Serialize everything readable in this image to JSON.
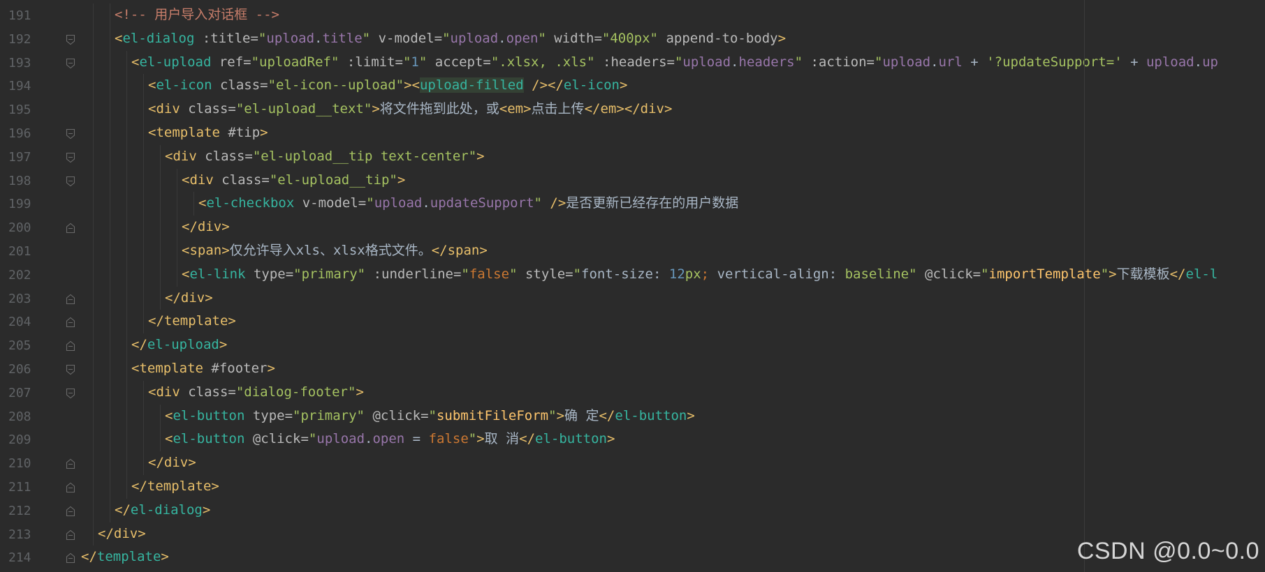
{
  "editor": {
    "watermark": "CSDN @0.0~0.0",
    "colors": {
      "background": "#2b2b2b",
      "line_number": "#606366",
      "tag": "#36b5a0",
      "tag_yellow": "#e8bf6a",
      "string": "#a5c261",
      "variable": "#9876aa",
      "keyword": "#cc7832",
      "comment": "#c67d6a"
    },
    "lines": [
      {
        "num": "191",
        "fold": "none",
        "indent": 2,
        "tokens": [
          {
            "t": "<!-- 用户导入对话框 -->",
            "c": "comment"
          }
        ]
      },
      {
        "num": "192",
        "fold": "open",
        "indent": 2,
        "tokens": [
          {
            "t": "<",
            "c": "brk"
          },
          {
            "t": "el-dialog",
            "c": "tag"
          },
          {
            "t": " :title=",
            "c": "attr"
          },
          {
            "t": "\"",
            "c": "str"
          },
          {
            "t": "upload",
            "c": "var"
          },
          {
            "t": ".",
            "c": "plain"
          },
          {
            "t": "title",
            "c": "var"
          },
          {
            "t": "\"",
            "c": "str"
          },
          {
            "t": " v-model=",
            "c": "attr"
          },
          {
            "t": "\"",
            "c": "str"
          },
          {
            "t": "upload",
            "c": "var"
          },
          {
            "t": ".",
            "c": "plain"
          },
          {
            "t": "open",
            "c": "var"
          },
          {
            "t": "\"",
            "c": "str"
          },
          {
            "t": " width=",
            "c": "attr"
          },
          {
            "t": "\"400px\"",
            "c": "str"
          },
          {
            "t": " append-to-body",
            "c": "attr"
          },
          {
            "t": ">",
            "c": "brk"
          }
        ]
      },
      {
        "num": "193",
        "fold": "open",
        "indent": 3,
        "tokens": [
          {
            "t": "<",
            "c": "brk"
          },
          {
            "t": "el-upload",
            "c": "tag"
          },
          {
            "t": " ref=",
            "c": "attr"
          },
          {
            "t": "\"uploadRef\"",
            "c": "str"
          },
          {
            "t": " :limit=",
            "c": "attr"
          },
          {
            "t": "\"",
            "c": "str"
          },
          {
            "t": "1",
            "c": "num"
          },
          {
            "t": "\"",
            "c": "str"
          },
          {
            "t": " accept=",
            "c": "attr"
          },
          {
            "t": "\".xlsx, .xls\"",
            "c": "str"
          },
          {
            "t": " :headers=",
            "c": "attr"
          },
          {
            "t": "\"",
            "c": "str"
          },
          {
            "t": "upload",
            "c": "var"
          },
          {
            "t": ".",
            "c": "plain"
          },
          {
            "t": "headers",
            "c": "var"
          },
          {
            "t": "\"",
            "c": "str"
          },
          {
            "t": " :action=",
            "c": "attr"
          },
          {
            "t": "\"",
            "c": "str"
          },
          {
            "t": "upload",
            "c": "var"
          },
          {
            "t": ".",
            "c": "plain"
          },
          {
            "t": "url",
            "c": "var"
          },
          {
            "t": " + ",
            "c": "plain"
          },
          {
            "t": "'?updateSupport='",
            "c": "str"
          },
          {
            "t": " + ",
            "c": "plain"
          },
          {
            "t": "upload",
            "c": "var"
          },
          {
            "t": ".",
            "c": "plain"
          },
          {
            "t": "up",
            "c": "var"
          }
        ]
      },
      {
        "num": "194",
        "fold": "none",
        "indent": 4,
        "tokens": [
          {
            "t": "<",
            "c": "brk"
          },
          {
            "t": "el-icon",
            "c": "tag"
          },
          {
            "t": " class=",
            "c": "attr"
          },
          {
            "t": "\"el-icon--upload\"",
            "c": "str"
          },
          {
            "t": "><",
            "c": "brk"
          },
          {
            "t": "upload-filled",
            "c": "tag",
            "hl": true
          },
          {
            "t": " />",
            "c": "brk"
          },
          {
            "t": "</",
            "c": "brk"
          },
          {
            "t": "el-icon",
            "c": "tag"
          },
          {
            "t": ">",
            "c": "brk"
          }
        ]
      },
      {
        "num": "195",
        "fold": "none",
        "indent": 4,
        "tokens": [
          {
            "t": "<div",
            "c": "tagy"
          },
          {
            "t": " class=",
            "c": "attr"
          },
          {
            "t": "\"el-upload__text\"",
            "c": "str"
          },
          {
            "t": ">",
            "c": "tagy"
          },
          {
            "t": "将文件拖到此处，或",
            "c": "plain"
          },
          {
            "t": "<em>",
            "c": "tagy"
          },
          {
            "t": "点击上传",
            "c": "plain"
          },
          {
            "t": "</em></div>",
            "c": "tagy"
          }
        ]
      },
      {
        "num": "196",
        "fold": "open",
        "indent": 4,
        "tokens": [
          {
            "t": "<template",
            "c": "tagy"
          },
          {
            "t": " #tip",
            "c": "attr"
          },
          {
            "t": ">",
            "c": "tagy"
          }
        ]
      },
      {
        "num": "197",
        "fold": "open",
        "indent": 5,
        "tokens": [
          {
            "t": "<div",
            "c": "tagy"
          },
          {
            "t": " class=",
            "c": "attr"
          },
          {
            "t": "\"el-upload__tip text-center\"",
            "c": "str"
          },
          {
            "t": ">",
            "c": "tagy"
          }
        ]
      },
      {
        "num": "198",
        "fold": "open",
        "indent": 6,
        "tokens": [
          {
            "t": "<div",
            "c": "tagy"
          },
          {
            "t": " class=",
            "c": "attr"
          },
          {
            "t": "\"el-upload__tip\"",
            "c": "str"
          },
          {
            "t": ">",
            "c": "tagy"
          }
        ]
      },
      {
        "num": "199",
        "fold": "none",
        "indent": 7,
        "tokens": [
          {
            "t": "<",
            "c": "brk"
          },
          {
            "t": "el-checkbox",
            "c": "tag"
          },
          {
            "t": " v-model=",
            "c": "attr"
          },
          {
            "t": "\"",
            "c": "str"
          },
          {
            "t": "upload",
            "c": "var"
          },
          {
            "t": ".",
            "c": "plain"
          },
          {
            "t": "updateSupport",
            "c": "var"
          },
          {
            "t": "\"",
            "c": "str"
          },
          {
            "t": " />",
            "c": "brk"
          },
          {
            "t": "是否更新已经存在的用户数据",
            "c": "plain"
          }
        ]
      },
      {
        "num": "200",
        "fold": "close",
        "indent": 6,
        "tokens": [
          {
            "t": "</div>",
            "c": "tagy"
          }
        ]
      },
      {
        "num": "201",
        "fold": "none",
        "indent": 6,
        "tokens": [
          {
            "t": "<span>",
            "c": "tagy"
          },
          {
            "t": "仅允许导入xls、xlsx格式文件。",
            "c": "plain"
          },
          {
            "t": "</span>",
            "c": "tagy"
          }
        ]
      },
      {
        "num": "202",
        "fold": "none",
        "indent": 6,
        "tokens": [
          {
            "t": "<",
            "c": "brk"
          },
          {
            "t": "el-link",
            "c": "tag"
          },
          {
            "t": " type=",
            "c": "attr"
          },
          {
            "t": "\"primary\"",
            "c": "str"
          },
          {
            "t": " :underline=",
            "c": "attr"
          },
          {
            "t": "\"",
            "c": "str"
          },
          {
            "t": "false",
            "c": "kw"
          },
          {
            "t": "\"",
            "c": "str"
          },
          {
            "t": " style=",
            "c": "attr"
          },
          {
            "t": "\"",
            "c": "str"
          },
          {
            "t": "font-size: ",
            "c": "plain"
          },
          {
            "t": "12",
            "c": "num"
          },
          {
            "t": "px",
            "c": "str"
          },
          {
            "t": "; ",
            "c": "kw"
          },
          {
            "t": "vertical-align: ",
            "c": "plain"
          },
          {
            "t": "baseline",
            "c": "str"
          },
          {
            "t": "\"",
            "c": "str"
          },
          {
            "t": " @click=",
            "c": "attr"
          },
          {
            "t": "\"",
            "c": "str"
          },
          {
            "t": "importTemplate",
            "c": "fn"
          },
          {
            "t": "\"",
            "c": "str"
          },
          {
            "t": ">",
            "c": "brk"
          },
          {
            "t": "下载模板",
            "c": "plain"
          },
          {
            "t": "</",
            "c": "brk"
          },
          {
            "t": "el-l",
            "c": "tag"
          }
        ]
      },
      {
        "num": "203",
        "fold": "close",
        "indent": 5,
        "tokens": [
          {
            "t": "</div>",
            "c": "tagy"
          }
        ]
      },
      {
        "num": "204",
        "fold": "close",
        "indent": 4,
        "tokens": [
          {
            "t": "</template>",
            "c": "tagy"
          }
        ]
      },
      {
        "num": "205",
        "fold": "close",
        "indent": 3,
        "tokens": [
          {
            "t": "</",
            "c": "brk"
          },
          {
            "t": "el-upload",
            "c": "tag"
          },
          {
            "t": ">",
            "c": "brk"
          }
        ]
      },
      {
        "num": "206",
        "fold": "open",
        "indent": 3,
        "tokens": [
          {
            "t": "<template",
            "c": "tagy"
          },
          {
            "t": " #footer",
            "c": "attr"
          },
          {
            "t": ">",
            "c": "tagy"
          }
        ]
      },
      {
        "num": "207",
        "fold": "open",
        "indent": 4,
        "tokens": [
          {
            "t": "<div",
            "c": "tagy"
          },
          {
            "t": " class=",
            "c": "attr"
          },
          {
            "t": "\"dialog-footer\"",
            "c": "str"
          },
          {
            "t": ">",
            "c": "tagy"
          }
        ]
      },
      {
        "num": "208",
        "fold": "none",
        "indent": 5,
        "tokens": [
          {
            "t": "<",
            "c": "brk"
          },
          {
            "t": "el-button",
            "c": "tag"
          },
          {
            "t": " type=",
            "c": "attr"
          },
          {
            "t": "\"primary\"",
            "c": "str"
          },
          {
            "t": " @click=",
            "c": "attr"
          },
          {
            "t": "\"",
            "c": "str"
          },
          {
            "t": "submitFileForm",
            "c": "fn"
          },
          {
            "t": "\"",
            "c": "str"
          },
          {
            "t": ">",
            "c": "brk"
          },
          {
            "t": "确 定",
            "c": "plain"
          },
          {
            "t": "</",
            "c": "brk"
          },
          {
            "t": "el-button",
            "c": "tag"
          },
          {
            "t": ">",
            "c": "brk"
          }
        ]
      },
      {
        "num": "209",
        "fold": "none",
        "indent": 5,
        "tokens": [
          {
            "t": "<",
            "c": "brk"
          },
          {
            "t": "el-button",
            "c": "tag"
          },
          {
            "t": " @click=",
            "c": "attr"
          },
          {
            "t": "\"",
            "c": "str"
          },
          {
            "t": "upload",
            "c": "var"
          },
          {
            "t": ".",
            "c": "plain"
          },
          {
            "t": "open",
            "c": "var"
          },
          {
            "t": " = ",
            "c": "plain"
          },
          {
            "t": "false",
            "c": "kw"
          },
          {
            "t": "\"",
            "c": "str"
          },
          {
            "t": ">",
            "c": "brk"
          },
          {
            "t": "取 消",
            "c": "plain"
          },
          {
            "t": "</",
            "c": "brk"
          },
          {
            "t": "el-button",
            "c": "tag"
          },
          {
            "t": ">",
            "c": "brk"
          }
        ]
      },
      {
        "num": "210",
        "fold": "close",
        "indent": 4,
        "tokens": [
          {
            "t": "</div>",
            "c": "tagy"
          }
        ]
      },
      {
        "num": "211",
        "fold": "close",
        "indent": 3,
        "tokens": [
          {
            "t": "</template>",
            "c": "tagy"
          }
        ]
      },
      {
        "num": "212",
        "fold": "close",
        "indent": 2,
        "tokens": [
          {
            "t": "</",
            "c": "brk"
          },
          {
            "t": "el-dialog",
            "c": "tag"
          },
          {
            "t": ">",
            "c": "brk"
          }
        ]
      },
      {
        "num": "213",
        "fold": "close",
        "indent": 1,
        "tokens": [
          {
            "t": "</div>",
            "c": "tagy"
          }
        ]
      },
      {
        "num": "214",
        "fold": "close",
        "indent": 0,
        "tokens": [
          {
            "t": "</",
            "c": "brk"
          },
          {
            "t": "template",
            "c": "tag"
          },
          {
            "t": ">",
            "c": "brk"
          }
        ]
      }
    ]
  }
}
